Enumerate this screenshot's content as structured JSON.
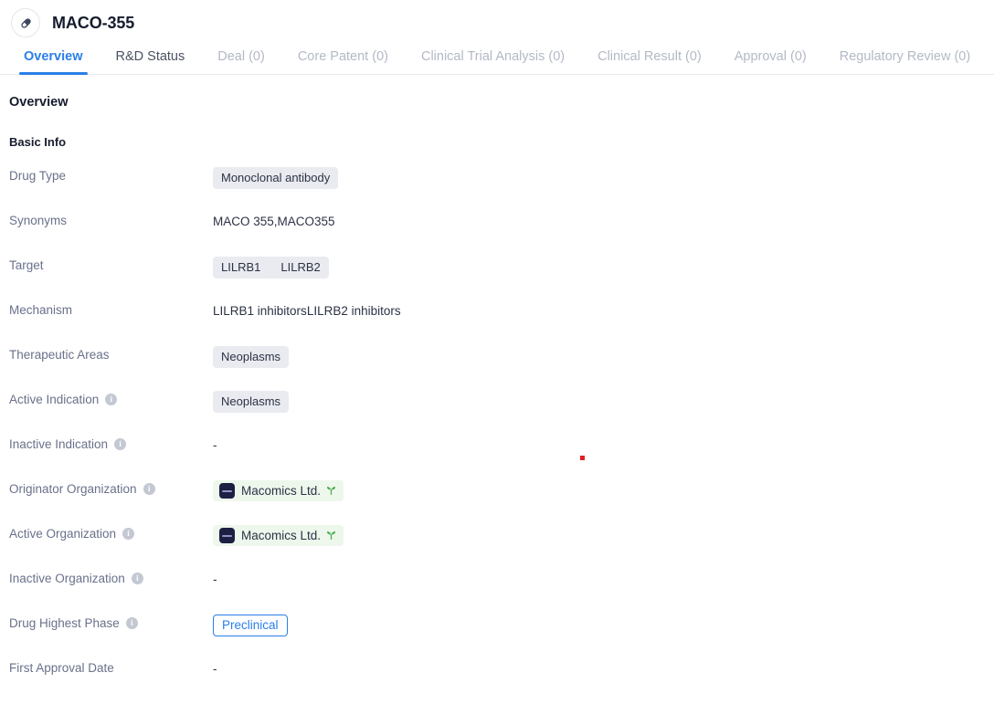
{
  "header": {
    "title": "MACO-355",
    "avatar_icon": "pill-capsule-icon"
  },
  "tabs": [
    {
      "label": "Overview",
      "state": "active"
    },
    {
      "label": "R&D Status",
      "state": "enabled"
    },
    {
      "label": "Deal (0)",
      "state": "disabled"
    },
    {
      "label": "Core Patent (0)",
      "state": "disabled"
    },
    {
      "label": "Clinical Trial Analysis (0)",
      "state": "disabled"
    },
    {
      "label": "Clinical Result (0)",
      "state": "disabled"
    },
    {
      "label": "Approval (0)",
      "state": "disabled"
    },
    {
      "label": "Regulatory Review (0)",
      "state": "disabled"
    }
  ],
  "overview": {
    "section_title": "Overview",
    "subsection_title": "Basic Info",
    "labels": {
      "drug_type": "Drug Type",
      "synonyms": "Synonyms",
      "target": "Target",
      "mechanism": "Mechanism",
      "therapeutic_areas": "Therapeutic Areas",
      "active_indication": "Active Indication",
      "inactive_indication": "Inactive Indication",
      "originator_organization": "Originator Organization",
      "active_organization": "Active Organization",
      "inactive_organization": "Inactive Organization",
      "drug_highest_phase": "Drug Highest Phase",
      "first_approval_date": "First Approval Date"
    },
    "values": {
      "drug_type": "Monoclonal antibody",
      "synonyms_1": "MACO 355,",
      "synonyms_2": "MACO355",
      "target_1": "LILRB1",
      "target_2": "LILRB2",
      "mechanism_1": "LILRB1 inhibitors",
      "mechanism_2": "LILRB2 inhibitors",
      "therapeutic_areas": "Neoplasms",
      "active_indication": "Neoplasms",
      "inactive_indication": "-",
      "originator_organization": "Macomics Ltd.",
      "active_organization": "Macomics Ltd.",
      "inactive_organization": "-",
      "drug_highest_phase": "Preclinical",
      "first_approval_date": "-"
    },
    "info_tooltip_glyph": "i"
  },
  "colors": {
    "accent_blue": "#2a7fe8",
    "label_gray": "#69718a",
    "chip_gray": "#e9ebf0",
    "org_chip_green": "#eef7ec",
    "sprout_green": "#4caf50",
    "logo_navy": "#1d1f43",
    "marker_red": "#e02020"
  }
}
